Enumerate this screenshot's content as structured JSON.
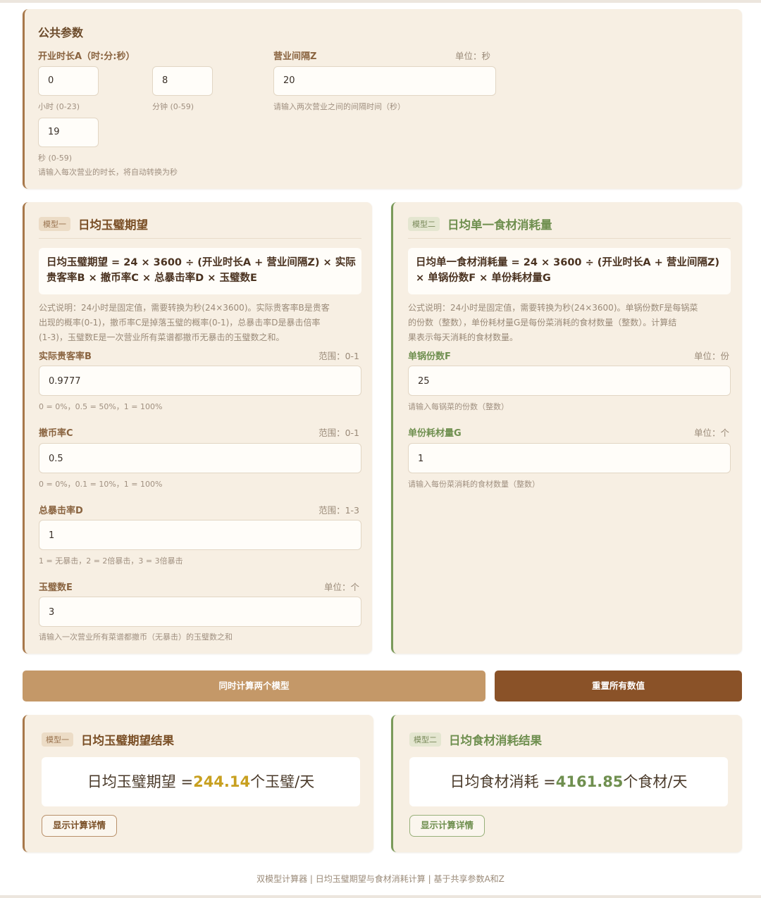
{
  "common": {
    "title": "公共参数",
    "duration_label": "开业时长A（时:分:秒）",
    "hours_value": "0",
    "hours_hint": "小时 (0-23)",
    "minutes_value": "8",
    "minutes_hint": "分钟 (0-59)",
    "seconds_value": "19",
    "seconds_hint": "秒 (0-59)",
    "duration_hint": "请输入每次营业的时长，将自动转换为秒",
    "interval_label": "营业间隔Z",
    "interval_unit": "单位：秒",
    "interval_value": "20",
    "interval_hint": "请输入两次营业之间的间隔时间（秒）"
  },
  "model1": {
    "badge": "模型一",
    "title": "日均玉璧期望",
    "formula_line1": "日均玉璧期望 = 24 × 3600 ÷ (开业时长A + 营业间隔Z) × 实际",
    "formula_line2": "贵客率B × 撤币率C × 总暴击率D × 玉璧数E",
    "desc_line1": "公式说明：24小时是固定值，需要转换为秒(24×3600)。实际贵客率B是贵客",
    "desc_line2": "出现的概率(0-1)，撤币率C是掉落玉璧的概率(0-1)，总暴击率D是暴击倍率",
    "desc_line3": "(1-3)，玉璧数E是一次营业所有菜谱都撤币无暴击的玉璧数之和。",
    "fields": [
      {
        "label": "实际贵客率B",
        "range": "范围：0-1",
        "value": "0.9777",
        "hint": "0 = 0%，0.5 = 50%，1 = 100%"
      },
      {
        "label": "撤币率C",
        "range": "范围：0-1",
        "value": "0.5",
        "hint": "0 = 0%，0.1 = 10%，1 = 100%"
      },
      {
        "label": "总暴击率D",
        "range": "范围：1-3",
        "value": "1",
        "hint": "1 = 无暴击，2 = 2倍暴击，3 = 3倍暴击"
      },
      {
        "label": "玉璧数E",
        "range": "单位：个",
        "value": "3",
        "hint": "请输入一次营业所有菜谱都撤币（无暴击）的玉璧数之和"
      }
    ]
  },
  "model2": {
    "badge": "模型二",
    "title": "日均单一食材消耗量",
    "formula_line1": "日均单一食材消耗量 = 24 × 3600 ÷ (开业时长A + 营业间隔Z)",
    "formula_line2": "× 单锅份数F × 单份耗材量G",
    "desc_line1": "公式说明：24小时是固定值，需要转换为秒(24×3600)。单锅份数F是每锅菜",
    "desc_line2": "的份数（整数），单份耗材量G是每份菜消耗的食材数量（整数）。计算结",
    "desc_line3": "果表示每天消耗的食材数量。",
    "fields": [
      {
        "label": "单锅份数F",
        "range": "单位：份",
        "value": "25",
        "hint": "请输入每锅菜的份数（整数）"
      },
      {
        "label": "单份耗材量G",
        "range": "单位：个",
        "value": "1",
        "hint": "请输入每份菜消耗的食材数量（整数）"
      }
    ]
  },
  "actions": {
    "calc_label": "同时计算两个模型",
    "reset_label": "重置所有数值"
  },
  "result1": {
    "badge": "模型一",
    "title": "日均玉璧期望结果",
    "prefix": "日均玉璧期望 =",
    "value": "244.14",
    "suffix": "个玉璧/天",
    "detail_btn": "显示计算详情"
  },
  "result2": {
    "badge": "模型二",
    "title": "日均食材消耗结果",
    "prefix": "日均食材消耗 =",
    "value": "4161.85",
    "suffix": "个食材/天",
    "detail_btn": "显示计算详情"
  },
  "footer": "双模型计算器 | 日均玉璧期望与食材消耗计算 | 基于共享参数A和Z",
  "colors": {
    "accent_brown": "#a8784a",
    "accent_green": "#7a9a5a",
    "button_light": "#c49868",
    "button_dark": "#8a5228",
    "result_gold": "#c8a020",
    "result_green": "#6f8f4f"
  }
}
